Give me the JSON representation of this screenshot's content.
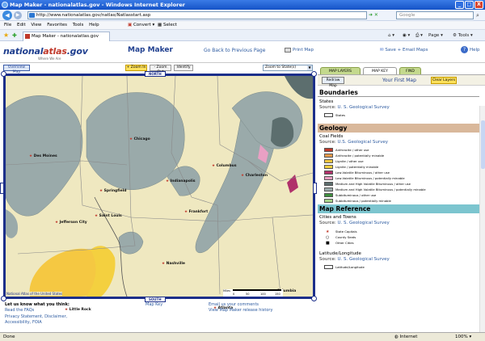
{
  "window": {
    "title": "Map Maker - nationalatlas.gov - Windows Internet Explorer",
    "minimize": "_",
    "maximize": "□",
    "close": "X"
  },
  "browser": {
    "url": "http://www.nationalatlas.gov/natlas/Natlasstart.asp",
    "search_placeholder": "Google",
    "menu": [
      "File",
      "Edit",
      "View",
      "Favorites",
      "Tools",
      "Help"
    ],
    "convert_label": "Convert",
    "select_label": "Select",
    "tab_title": "Map Maker - nationalatlas.gov",
    "page_label": "Page",
    "tools_label": "Tools"
  },
  "header": {
    "logo_main": "national",
    "logo_accent": "atlas",
    "logo_suffix": ".gov",
    "tagline": "Where We Are",
    "app_title": "Map Maker",
    "go_back": "Go Back to Previous Page",
    "print_map": "Print Map",
    "save_email": "Save + Email Maps",
    "help": "Help"
  },
  "toolbar": {
    "overview_map": "Overview Map",
    "zoom_in": "+ Zoom In",
    "zoom_out": "- Zoom Out",
    "identify": "Identify",
    "zoom_state": "Zoom to State(s)"
  },
  "map": {
    "north": "NORTH",
    "south": "SOUTH",
    "west": "W",
    "east": "E",
    "copyright": "National Atlas of the United States",
    "scale_units": "Miles",
    "scale_ticks": [
      "0",
      "50",
      "100",
      "150"
    ],
    "cities": [
      {
        "name": "Des Moines"
      },
      {
        "name": "Chicago"
      },
      {
        "name": "Columbus"
      },
      {
        "name": "Indianapolis"
      },
      {
        "name": "Springfield"
      },
      {
        "name": "Charleston"
      },
      {
        "name": "Saint Louis"
      },
      {
        "name": "Frankfort"
      },
      {
        "name": "Jefferson City"
      },
      {
        "name": "Nashville"
      },
      {
        "name": "Columbia"
      },
      {
        "name": "Little Rock"
      },
      {
        "name": "Atlanta"
      }
    ]
  },
  "footer": {
    "let_us_know": "Let us know what you think:",
    "faqs": "Read the FAQs",
    "privacy": "Privacy Statement, Disclaimer,",
    "accessibility": "Accessibility, FOIA",
    "map_key": "Map Key",
    "email": "Email us your comments",
    "release_history": "View Map Maker release history"
  },
  "side": {
    "tabs": {
      "layers": "MAP LAYERS",
      "key": "MAP KEY",
      "find": "FIND"
    },
    "redraw": "Redraw Map",
    "your_first_map": "Your First Map",
    "clear_layers": "Clear Layers",
    "boundaries": {
      "title": "Boundaries",
      "layer": "States",
      "source_label": "Source:",
      "source": "U. S. Geological Survey",
      "item": "States"
    },
    "geology": {
      "title": "Geology",
      "layer": "Coal Fields",
      "source_label": "Source:",
      "source": "U.S. Geological Survey",
      "items": [
        {
          "label": "Anthracite / other use",
          "color": "#c0392b"
        },
        {
          "label": "Anthracite / potentially minable",
          "color": "#e89a4a"
        },
        {
          "label": "Lignite / other use",
          "color": "#f5c842"
        },
        {
          "label": "Lignite / potentially minable",
          "color": "#f4d03f"
        },
        {
          "label": "Low-Volatile Bituminous / other use",
          "color": "#b0306a"
        },
        {
          "label": "Low-Volatile Bituminous / potentially minable",
          "color": "#e9a0c4"
        },
        {
          "label": "Medium and High Volatile Bituminous / other use",
          "color": "#5c6e6e"
        },
        {
          "label": "Medium and High Volatile Bituminous / potentially minable",
          "color": "#9aaaaa"
        },
        {
          "label": "Subbituminous / other use",
          "color": "#3f8f3f"
        },
        {
          "label": "Subbituminous / potentially minable",
          "color": "#a8d58a"
        }
      ]
    },
    "reference": {
      "title": "Map Reference",
      "layer": "Cities and Towns",
      "source_label": "Source:",
      "source": "U. S. Geological Survey",
      "items": [
        "State Capitals",
        "County Seats",
        "Other Cities"
      ],
      "layer2": "Latitude/Longitude",
      "source2": "U. S. Geological Survey",
      "item2": "Latitude/Longitude"
    }
  },
  "status": {
    "left": "Done",
    "zone": "Internet",
    "zoom": "100%"
  }
}
